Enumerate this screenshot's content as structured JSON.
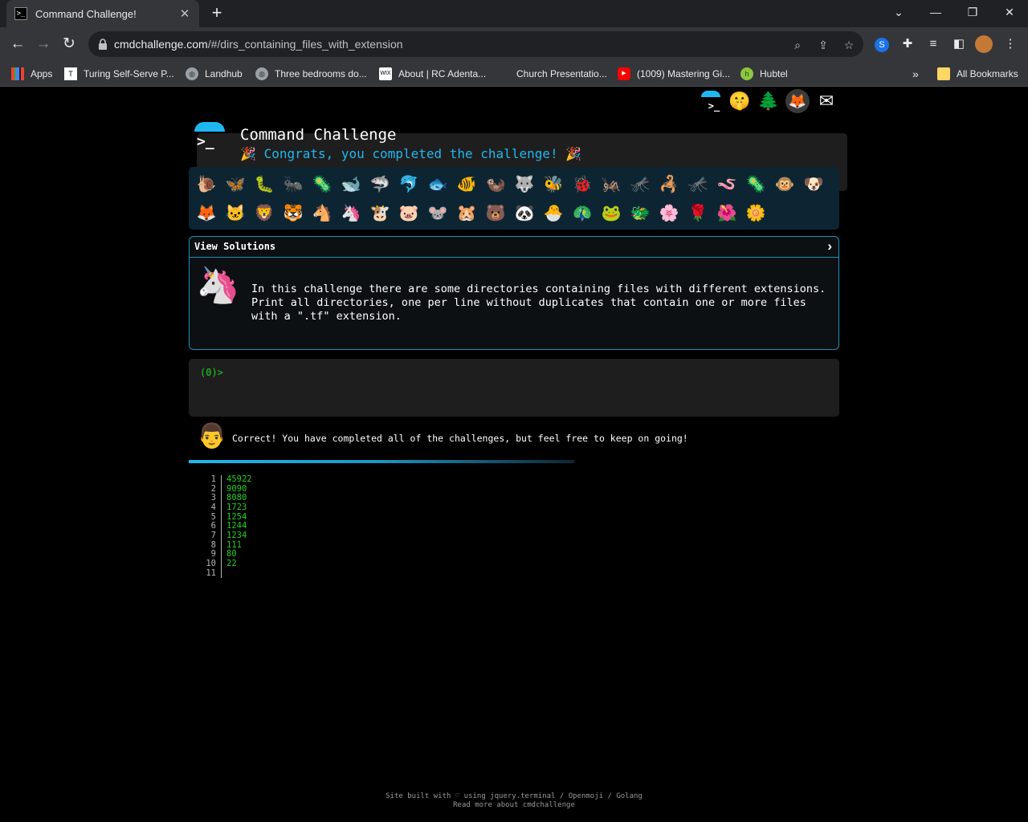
{
  "browser": {
    "tab_title": "Command Challenge!",
    "url_host": "cmdchallenge.com",
    "url_path": "/#/dirs_containing_files_with_extension",
    "bookmarks": [
      {
        "label": "Apps",
        "icon": "apps-grid-icon"
      },
      {
        "label": "Turing Self-Serve P...",
        "icon": "turing-icon"
      },
      {
        "label": "Landhub",
        "icon": "globe-icon"
      },
      {
        "label": "Three bedrooms do...",
        "icon": "globe-icon"
      },
      {
        "label": "About | RC Adenta...",
        "icon": "wix-icon"
      },
      {
        "label": "Church Presentatio...",
        "icon": "blank-icon"
      },
      {
        "label": "(1009) Mastering Gi...",
        "icon": "youtube-icon"
      },
      {
        "label": "Hubtel",
        "icon": "hubtel-icon"
      }
    ],
    "all_bookmarks": "All Bookmarks"
  },
  "page": {
    "title": "Command Challenge",
    "congrats": "Congrats, you completed the challenge!",
    "view_solutions": "View Solutions",
    "description": "In this challenge there are some directories containing files with different extensions. Print all directories, one per line without duplicates that contain one or more files with a \".tf\" extension.",
    "prompt": "(0)>",
    "result_message": "Correct! You have completed all of the challenges, but feel free to keep on going!",
    "output_lines": [
      "45922",
      "9090",
      "8080",
      "1723",
      "1254",
      "1244",
      "1234",
      "111",
      "80",
      "22",
      ""
    ],
    "footer_line1": "Site built with ♡ using jquery.terminal / Openmoji / Golang",
    "footer_line2": "Read more about cmdchallenge"
  },
  "emoji_row1": [
    "🐌",
    "🦋",
    "🐛",
    "🐜",
    "🦠",
    "🐋",
    "🦈",
    "🐬",
    "🐟",
    "🐠",
    "🦦",
    "🐺",
    "🐝",
    "🐞",
    "🦗",
    "🦟",
    "🦂",
    "🦟",
    "🪱",
    "🦠",
    "🐵",
    "🐶"
  ],
  "emoji_row2": [
    "🦊",
    "🐱",
    "🦁",
    "🐯",
    "🐴",
    "🦄",
    "🐮",
    "🐷",
    "🐭",
    "🐹",
    "🐻",
    "🐼",
    "🐣",
    "🦚",
    "🐸",
    "🐲",
    "🌸",
    "🌹",
    "🌺",
    "🌼"
  ],
  "colors": {
    "accent": "#1eb8f0",
    "terminal_green": "#1ed31e",
    "icon_bar_bg": "#0d2533"
  }
}
